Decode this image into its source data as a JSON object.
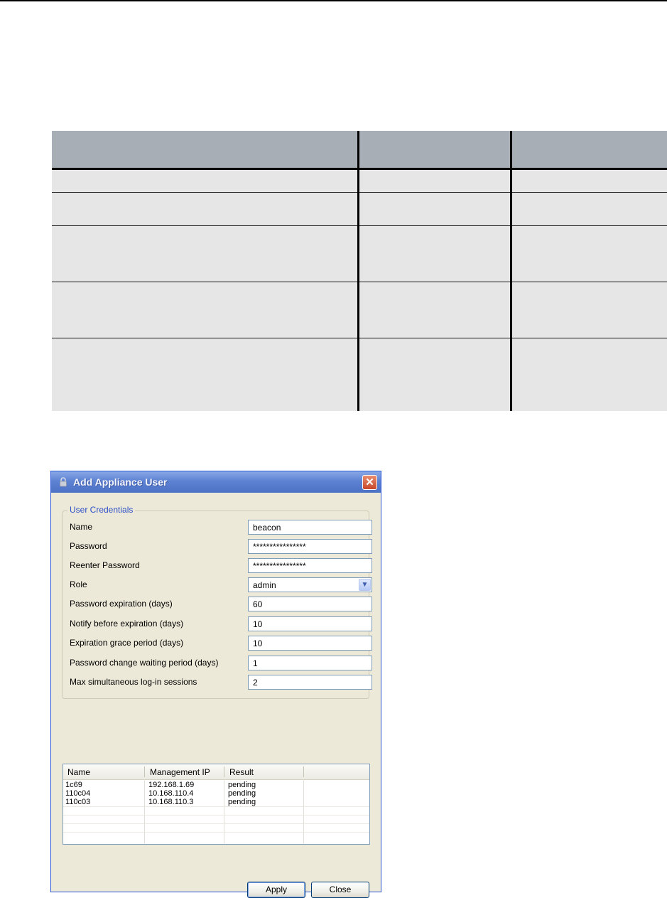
{
  "dialog": {
    "title": "Add Appliance User",
    "close_glyph": "✕",
    "group_label": "User Credentials",
    "fields": [
      {
        "label": "Name",
        "value": "beacon"
      },
      {
        "label": "Password",
        "value": "****************"
      },
      {
        "label": "Reenter Password",
        "value": "****************"
      },
      {
        "label": "Role",
        "value": "admin"
      },
      {
        "label": "Password expiration (days)",
        "value": "60"
      },
      {
        "label": "Notify before expiration (days)",
        "value": "10"
      },
      {
        "label": "Expiration grace period (days)",
        "value": "10"
      },
      {
        "label": "Password change waiting period (days)",
        "value": "1"
      },
      {
        "label": "Max simultaneous log-in sessions",
        "value": "2"
      }
    ],
    "list": {
      "columns": [
        "Name",
        "Management IP",
        "Result"
      ],
      "rows": [
        [
          "1c69",
          "192.168.1.69",
          "pending"
        ],
        [
          "110c04",
          "10.168.110.4",
          "pending"
        ],
        [
          "110c03",
          "10.168.110.3",
          "pending"
        ]
      ]
    },
    "buttons": {
      "apply": "Apply",
      "close": "Close"
    },
    "icons": {
      "title": "lock-icon",
      "close": "close-icon",
      "dropdown": "chevron-down-icon"
    },
    "colors": {
      "title_bar": "#4c72c6",
      "legend": "#2c4fc7",
      "dialog_bg": "#ece9d8"
    }
  },
  "doc_table": {
    "header_color": "#a7aeb6",
    "row_color": "#e6e6e6"
  }
}
